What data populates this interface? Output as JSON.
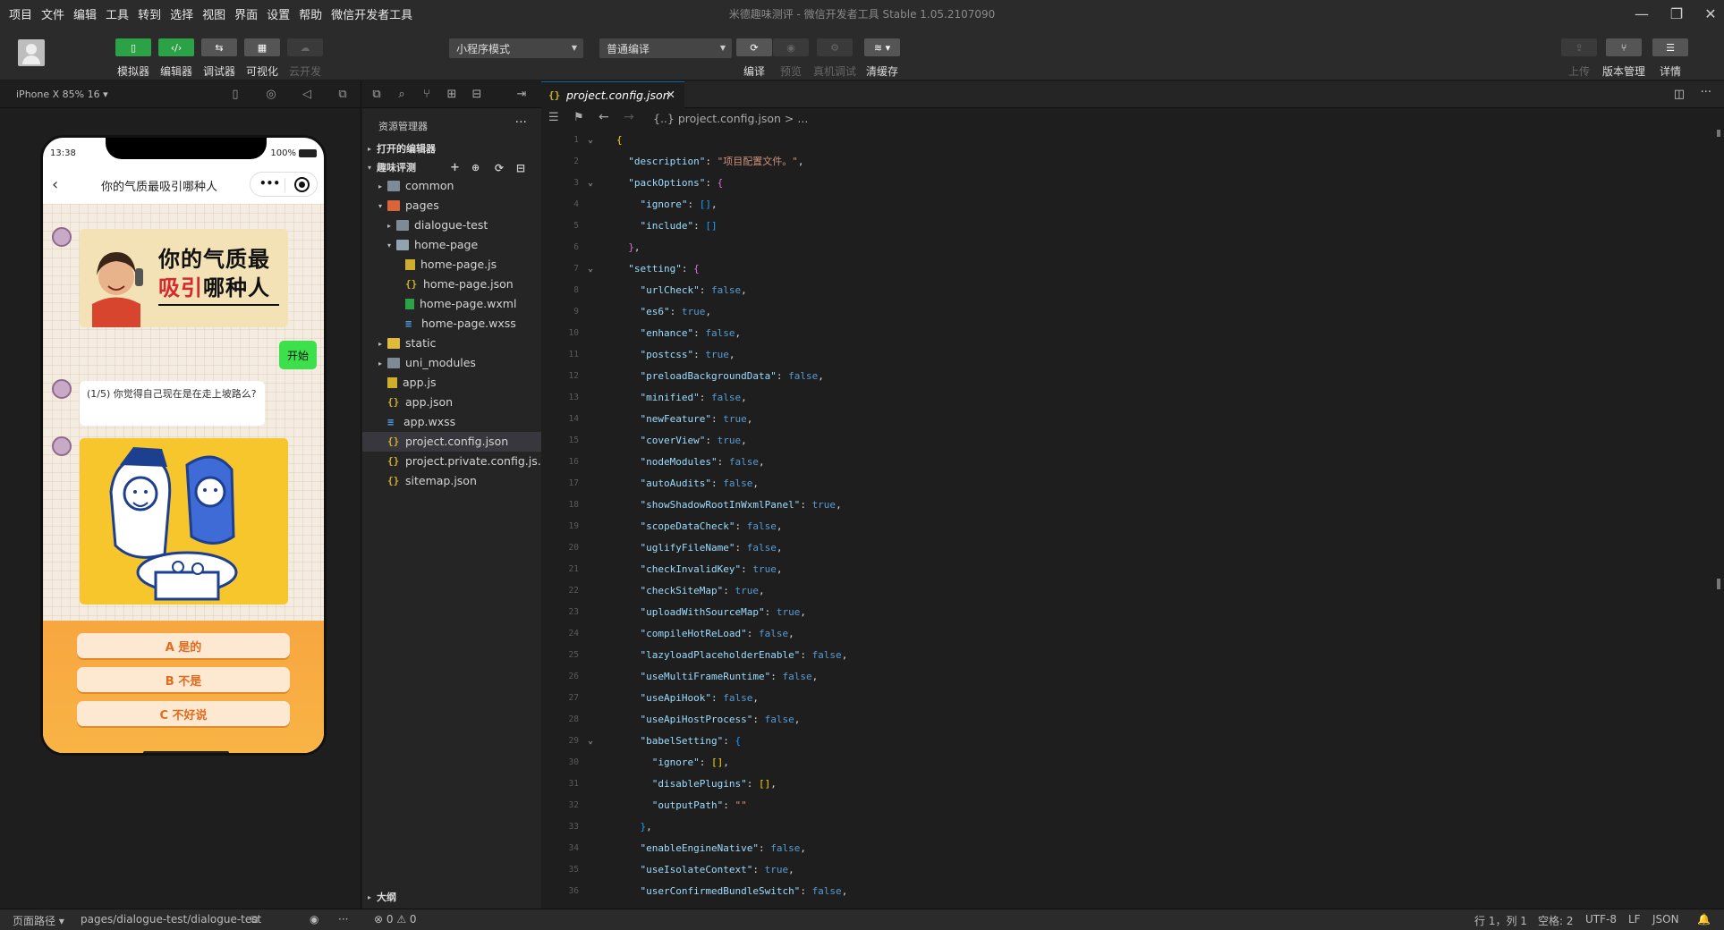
{
  "menubar": {
    "items": [
      "项目",
      "文件",
      "编辑",
      "工具",
      "转到",
      "选择",
      "视图",
      "界面",
      "设置",
      "帮助",
      "微信开发者工具"
    ],
    "title": "米德趣味测评 - 微信开发者工具 Stable 1.05.2107090"
  },
  "toolbar": {
    "simulator": "模拟器",
    "editor": "编辑器",
    "debugger": "调试器",
    "visual": "可视化",
    "cloud": "云开发",
    "mode_select": "小程序模式",
    "compile_select": "普通编译",
    "compile": "编译",
    "preview": "预览",
    "remote_debug": "真机调试",
    "clear_cache": "清缓存",
    "upload": "上传",
    "version": "版本管理",
    "details": "详情"
  },
  "simulator": {
    "device": "iPhone X 85% 16 ▾",
    "time": "13:38",
    "battery": "100%",
    "nav_title": "你的气质最吸引哪种人",
    "banner_line1": "你的气质最",
    "banner_line2_red": "吸引",
    "banner_line2_black": "哪种人",
    "start_button": "开始",
    "question": "(1/5) 你觉得自己现在是在走上坡路么?",
    "answers": [
      "A 是的",
      "B 不是",
      "C 不好说"
    ]
  },
  "explorer": {
    "title": "资源管理器",
    "open_editors": "打开的编辑器",
    "project": "趣味评测",
    "outline": "大纲",
    "tree": [
      {
        "label": "common",
        "depth": 1,
        "type": "folder",
        "twisty": "▸"
      },
      {
        "label": "pages",
        "depth": 1,
        "type": "folder-red",
        "twisty": "▾"
      },
      {
        "label": "dialogue-test",
        "depth": 2,
        "type": "folder",
        "twisty": "▸"
      },
      {
        "label": "home-page",
        "depth": 2,
        "type": "folder-open",
        "twisty": "▾"
      },
      {
        "label": "home-page.js",
        "depth": 3,
        "type": "js",
        "twisty": ""
      },
      {
        "label": "home-page.json",
        "depth": 3,
        "type": "json",
        "twisty": ""
      },
      {
        "label": "home-page.wxml",
        "depth": 3,
        "type": "wxml",
        "twisty": ""
      },
      {
        "label": "home-page.wxss",
        "depth": 3,
        "type": "wxss",
        "twisty": ""
      },
      {
        "label": "static",
        "depth": 1,
        "type": "folder-yellow",
        "twisty": "▸"
      },
      {
        "label": "uni_modules",
        "depth": 1,
        "type": "folder",
        "twisty": "▸"
      },
      {
        "label": "app.js",
        "depth": 1,
        "type": "js",
        "twisty": ""
      },
      {
        "label": "app.json",
        "depth": 1,
        "type": "json",
        "twisty": ""
      },
      {
        "label": "app.wxss",
        "depth": 1,
        "type": "wxss",
        "twisty": ""
      },
      {
        "label": "project.config.json",
        "depth": 1,
        "type": "json",
        "twisty": "",
        "selected": true
      },
      {
        "label": "project.private.config.js...",
        "depth": 1,
        "type": "json",
        "twisty": ""
      },
      {
        "label": "sitemap.json",
        "depth": 1,
        "type": "json",
        "twisty": ""
      }
    ]
  },
  "editor": {
    "tab": "project.config.json",
    "breadcrumb": "{..} project.config.json > ...",
    "lines": [
      {
        "n": "1",
        "fold": true,
        "t": [
          [
            "br1",
            "{"
          ]
        ]
      },
      {
        "n": "2",
        "t": [
          [
            "p",
            "  "
          ],
          [
            "k",
            "\"description\""
          ],
          [
            "p",
            ": "
          ],
          [
            "s",
            "\"项目配置文件。\""
          ],
          [
            "p",
            ","
          ]
        ]
      },
      {
        "n": "3",
        "fold": true,
        "t": [
          [
            "p",
            "  "
          ],
          [
            "k",
            "\"packOptions\""
          ],
          [
            "p",
            ": "
          ],
          [
            "br2",
            "{"
          ]
        ]
      },
      {
        "n": "4",
        "t": [
          [
            "p",
            "    "
          ],
          [
            "k",
            "\"ignore\""
          ],
          [
            "p",
            ": "
          ],
          [
            "br3",
            "[]"
          ],
          [
            "p",
            ","
          ]
        ]
      },
      {
        "n": "5",
        "t": [
          [
            "p",
            "    "
          ],
          [
            "k",
            "\"include\""
          ],
          [
            "p",
            ": "
          ],
          [
            "br3",
            "[]"
          ]
        ]
      },
      {
        "n": "6",
        "t": [
          [
            "p",
            "  "
          ],
          [
            "br2",
            "}"
          ],
          [
            "p",
            ","
          ]
        ]
      },
      {
        "n": "7",
        "fold": true,
        "t": [
          [
            "p",
            "  "
          ],
          [
            "k",
            "\"setting\""
          ],
          [
            "p",
            ": "
          ],
          [
            "br2",
            "{"
          ]
        ]
      },
      {
        "n": "8",
        "t": [
          [
            "p",
            "    "
          ],
          [
            "k",
            "\"urlCheck\""
          ],
          [
            "p",
            ": "
          ],
          [
            "b",
            "false"
          ],
          [
            "p",
            ","
          ]
        ]
      },
      {
        "n": "9",
        "t": [
          [
            "p",
            "    "
          ],
          [
            "k",
            "\"es6\""
          ],
          [
            "p",
            ": "
          ],
          [
            "b",
            "true"
          ],
          [
            "p",
            ","
          ]
        ]
      },
      {
        "n": "10",
        "t": [
          [
            "p",
            "    "
          ],
          [
            "k",
            "\"enhance\""
          ],
          [
            "p",
            ": "
          ],
          [
            "b",
            "false"
          ],
          [
            "p",
            ","
          ]
        ]
      },
      {
        "n": "11",
        "t": [
          [
            "p",
            "    "
          ],
          [
            "k",
            "\"postcss\""
          ],
          [
            "p",
            ": "
          ],
          [
            "b",
            "true"
          ],
          [
            "p",
            ","
          ]
        ]
      },
      {
        "n": "12",
        "t": [
          [
            "p",
            "    "
          ],
          [
            "k",
            "\"preloadBackgroundData\""
          ],
          [
            "p",
            ": "
          ],
          [
            "b",
            "false"
          ],
          [
            "p",
            ","
          ]
        ]
      },
      {
        "n": "13",
        "t": [
          [
            "p",
            "    "
          ],
          [
            "k",
            "\"minified\""
          ],
          [
            "p",
            ": "
          ],
          [
            "b",
            "false"
          ],
          [
            "p",
            ","
          ]
        ]
      },
      {
        "n": "14",
        "t": [
          [
            "p",
            "    "
          ],
          [
            "k",
            "\"newFeature\""
          ],
          [
            "p",
            ": "
          ],
          [
            "b",
            "true"
          ],
          [
            "p",
            ","
          ]
        ]
      },
      {
        "n": "15",
        "t": [
          [
            "p",
            "    "
          ],
          [
            "k",
            "\"coverView\""
          ],
          [
            "p",
            ": "
          ],
          [
            "b",
            "true"
          ],
          [
            "p",
            ","
          ]
        ]
      },
      {
        "n": "16",
        "t": [
          [
            "p",
            "    "
          ],
          [
            "k",
            "\"nodeModules\""
          ],
          [
            "p",
            ": "
          ],
          [
            "b",
            "false"
          ],
          [
            "p",
            ","
          ]
        ]
      },
      {
        "n": "17",
        "t": [
          [
            "p",
            "    "
          ],
          [
            "k",
            "\"autoAudits\""
          ],
          [
            "p",
            ": "
          ],
          [
            "b",
            "false"
          ],
          [
            "p",
            ","
          ]
        ]
      },
      {
        "n": "18",
        "t": [
          [
            "p",
            "    "
          ],
          [
            "k",
            "\"showShadowRootInWxmlPanel\""
          ],
          [
            "p",
            ": "
          ],
          [
            "b",
            "true"
          ],
          [
            "p",
            ","
          ]
        ]
      },
      {
        "n": "19",
        "t": [
          [
            "p",
            "    "
          ],
          [
            "k",
            "\"scopeDataCheck\""
          ],
          [
            "p",
            ": "
          ],
          [
            "b",
            "false"
          ],
          [
            "p",
            ","
          ]
        ]
      },
      {
        "n": "20",
        "t": [
          [
            "p",
            "    "
          ],
          [
            "k",
            "\"uglifyFileName\""
          ],
          [
            "p",
            ": "
          ],
          [
            "b",
            "false"
          ],
          [
            "p",
            ","
          ]
        ]
      },
      {
        "n": "21",
        "t": [
          [
            "p",
            "    "
          ],
          [
            "k",
            "\"checkInvalidKey\""
          ],
          [
            "p",
            ": "
          ],
          [
            "b",
            "true"
          ],
          [
            "p",
            ","
          ]
        ]
      },
      {
        "n": "22",
        "t": [
          [
            "p",
            "    "
          ],
          [
            "k",
            "\"checkSiteMap\""
          ],
          [
            "p",
            ": "
          ],
          [
            "b",
            "true"
          ],
          [
            "p",
            ","
          ]
        ]
      },
      {
        "n": "23",
        "t": [
          [
            "p",
            "    "
          ],
          [
            "k",
            "\"uploadWithSourceMap\""
          ],
          [
            "p",
            ": "
          ],
          [
            "b",
            "true"
          ],
          [
            "p",
            ","
          ]
        ]
      },
      {
        "n": "24",
        "t": [
          [
            "p",
            "    "
          ],
          [
            "k",
            "\"compileHotReLoad\""
          ],
          [
            "p",
            ": "
          ],
          [
            "b",
            "false"
          ],
          [
            "p",
            ","
          ]
        ]
      },
      {
        "n": "25",
        "t": [
          [
            "p",
            "    "
          ],
          [
            "k",
            "\"lazyloadPlaceholderEnable\""
          ],
          [
            "p",
            ": "
          ],
          [
            "b",
            "false"
          ],
          [
            "p",
            ","
          ]
        ]
      },
      {
        "n": "26",
        "t": [
          [
            "p",
            "    "
          ],
          [
            "k",
            "\"useMultiFrameRuntime\""
          ],
          [
            "p",
            ": "
          ],
          [
            "b",
            "false"
          ],
          [
            "p",
            ","
          ]
        ]
      },
      {
        "n": "27",
        "t": [
          [
            "p",
            "    "
          ],
          [
            "k",
            "\"useApiHook\""
          ],
          [
            "p",
            ": "
          ],
          [
            "b",
            "false"
          ],
          [
            "p",
            ","
          ]
        ]
      },
      {
        "n": "28",
        "t": [
          [
            "p",
            "    "
          ],
          [
            "k",
            "\"useApiHostProcess\""
          ],
          [
            "p",
            ": "
          ],
          [
            "b",
            "false"
          ],
          [
            "p",
            ","
          ]
        ]
      },
      {
        "n": "29",
        "fold": true,
        "t": [
          [
            "p",
            "    "
          ],
          [
            "k",
            "\"babelSetting\""
          ],
          [
            "p",
            ": "
          ],
          [
            "br3",
            "{"
          ]
        ]
      },
      {
        "n": "30",
        "t": [
          [
            "p",
            "      "
          ],
          [
            "k",
            "\"ignore\""
          ],
          [
            "p",
            ": "
          ],
          [
            "br1",
            "[]"
          ],
          [
            "p",
            ","
          ]
        ]
      },
      {
        "n": "31",
        "t": [
          [
            "p",
            "      "
          ],
          [
            "k",
            "\"disablePlugins\""
          ],
          [
            "p",
            ": "
          ],
          [
            "br1",
            "[]"
          ],
          [
            "p",
            ","
          ]
        ]
      },
      {
        "n": "32",
        "t": [
          [
            "p",
            "      "
          ],
          [
            "k",
            "\"outputPath\""
          ],
          [
            "p",
            ": "
          ],
          [
            "s",
            "\"\""
          ]
        ]
      },
      {
        "n": "33",
        "t": [
          [
            "p",
            "    "
          ],
          [
            "br3",
            "}"
          ],
          [
            "p",
            ","
          ]
        ]
      },
      {
        "n": "34",
        "t": [
          [
            "p",
            "    "
          ],
          [
            "k",
            "\"enableEngineNative\""
          ],
          [
            "p",
            ": "
          ],
          [
            "b",
            "false"
          ],
          [
            "p",
            ","
          ]
        ]
      },
      {
        "n": "35",
        "t": [
          [
            "p",
            "    "
          ],
          [
            "k",
            "\"useIsolateContext\""
          ],
          [
            "p",
            ": "
          ],
          [
            "b",
            "true"
          ],
          [
            "p",
            ","
          ]
        ]
      },
      {
        "n": "36",
        "t": [
          [
            "p",
            "    "
          ],
          [
            "k",
            "\"userConfirmedBundleSwitch\""
          ],
          [
            "p",
            ": "
          ],
          [
            "b",
            "false"
          ],
          [
            "p",
            ","
          ]
        ]
      }
    ]
  },
  "status": {
    "page_path_label": "页面路径 ▾",
    "page_path": "pages/dialogue-test/dialogue-test",
    "problems": "⊗ 0 ⚠ 0",
    "position": "行 1，列 1",
    "spaces": "空格: 2",
    "encoding": "UTF-8",
    "eol": "LF",
    "language": "JSON"
  }
}
